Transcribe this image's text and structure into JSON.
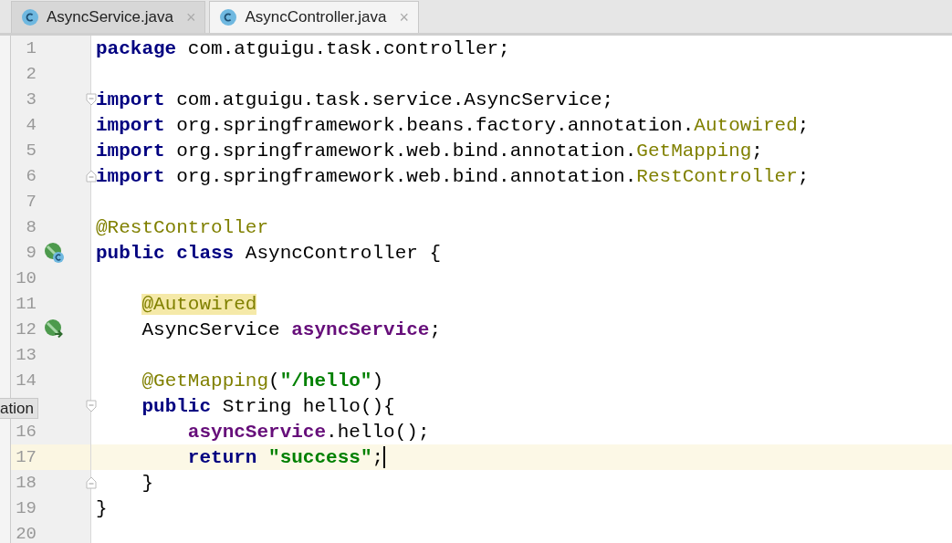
{
  "tabs": [
    {
      "label": "AsyncService.java",
      "close": "×",
      "selected": false
    },
    {
      "label": "AsyncController.java",
      "close": "×",
      "selected": true
    }
  ],
  "tooltip": "ation",
  "lines": [
    {
      "number": "1",
      "current": false,
      "tokens": [
        {
          "kind": "keyword",
          "text": "package"
        },
        {
          "kind": "plain",
          "text": " com.atguigu.task.controller;"
        }
      ]
    },
    {
      "number": "2",
      "current": false
    },
    {
      "number": "3",
      "current": false,
      "fold": {
        "kind": "start"
      },
      "tokens": [
        {
          "kind": "keyword",
          "text": "import"
        },
        {
          "kind": "plain",
          "text": " com.atguigu.task.service.AsyncService;"
        }
      ]
    },
    {
      "number": "4",
      "current": false,
      "tokens": [
        {
          "kind": "keyword",
          "text": "import"
        },
        {
          "kind": "plain",
          "text": " org.springframework.beans.factory.annotation."
        },
        {
          "kind": "annotation",
          "text": "Autowired"
        },
        {
          "kind": "plain",
          "text": ";"
        }
      ]
    },
    {
      "number": "5",
      "current": false,
      "tokens": [
        {
          "kind": "keyword",
          "text": "import"
        },
        {
          "kind": "plain",
          "text": " org.springframework.web.bind.annotation."
        },
        {
          "kind": "annotation",
          "text": "GetMapping"
        },
        {
          "kind": "plain",
          "text": ";"
        }
      ]
    },
    {
      "number": "6",
      "current": false,
      "fold": {
        "kind": "end"
      },
      "tokens": [
        {
          "kind": "keyword",
          "text": "import"
        },
        {
          "kind": "plain",
          "text": " org.springframework.web.bind.annotation."
        },
        {
          "kind": "annotation",
          "text": "RestController"
        },
        {
          "kind": "plain",
          "text": ";"
        }
      ]
    },
    {
      "number": "7",
      "current": false
    },
    {
      "number": "8",
      "current": false,
      "tokens": [
        {
          "kind": "annotation",
          "text": "@RestController"
        }
      ]
    },
    {
      "number": "9",
      "current": false,
      "gutter_icon": {
        "kind": "bean_class"
      },
      "tokens": [
        {
          "kind": "keyword",
          "text": "public class"
        },
        {
          "kind": "plain",
          "text": " AsyncController {"
        }
      ]
    },
    {
      "number": "10",
      "current": false
    },
    {
      "number": "11",
      "current": false,
      "tokens": [
        {
          "kind": "annotation_match",
          "text": "    @Autowired"
        }
      ]
    },
    {
      "number": "12",
      "current": false,
      "gutter_icon": {
        "kind": "bean_inject"
      },
      "tokens": [
        {
          "kind": "plain",
          "text": "    AsyncService "
        },
        {
          "kind": "field",
          "text": "asyncService"
        },
        {
          "kind": "plain",
          "text": ";"
        }
      ]
    },
    {
      "number": "13",
      "current": false
    },
    {
      "number": "14",
      "current": false,
      "tokens": [
        {
          "kind": "annotation",
          "text": "    @GetMapping"
        },
        {
          "kind": "plain",
          "text": "("
        },
        {
          "kind": "string",
          "text": "\"/hello\""
        },
        {
          "kind": "plain",
          "text": ")"
        }
      ]
    },
    {
      "current": false,
      "fold": {
        "kind": "start"
      },
      "tokens": [
        {
          "kind": "keyword",
          "text": "    public"
        },
        {
          "kind": "plain",
          "text": " String hello(){"
        }
      ]
    },
    {
      "number": "16",
      "current": false,
      "tokens": [
        {
          "kind": "field",
          "text": "        asyncService"
        },
        {
          "kind": "plain",
          "text": ".hello();"
        }
      ]
    },
    {
      "number": "17",
      "current": true,
      "tokens": [
        {
          "kind": "keyword",
          "text": "        return"
        },
        {
          "kind": "string",
          "text": " \"success\""
        },
        {
          "kind": "plain",
          "text": ";"
        }
      ]
    },
    {
      "number": "18",
      "current": false,
      "fold": {
        "kind": "end"
      },
      "tokens": [
        {
          "kind": "plain",
          "text": "    }"
        }
      ]
    },
    {
      "number": "19",
      "current": false,
      "tokens": [
        {
          "kind": "plain",
          "text": "}"
        }
      ]
    },
    {
      "number": "20",
      "current": false
    }
  ]
}
